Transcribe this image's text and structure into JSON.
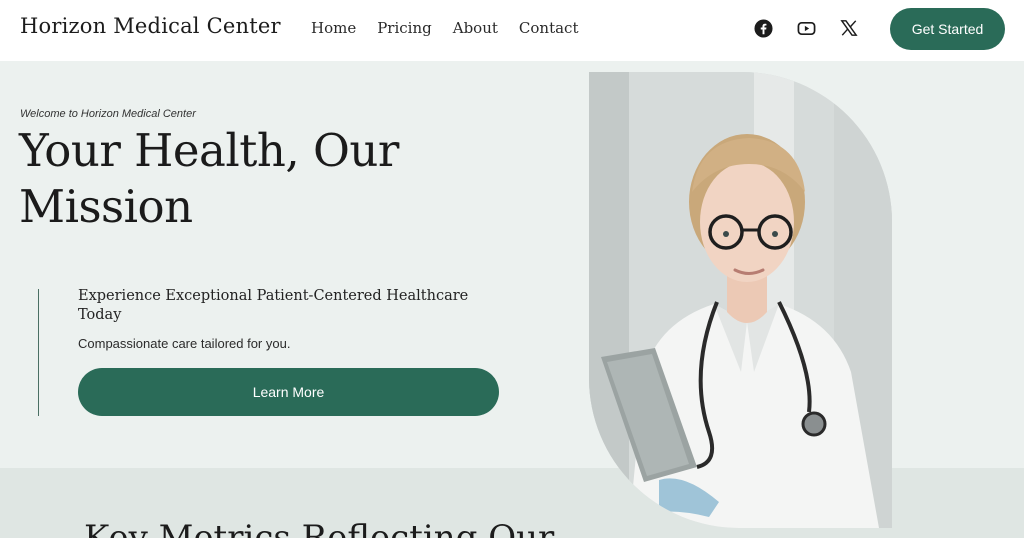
{
  "header": {
    "brand": "Horizon Medical Center",
    "nav": [
      "Home",
      "Pricing",
      "About",
      "Contact"
    ],
    "socials": [
      "facebook-icon",
      "youtube-icon",
      "x-icon"
    ],
    "cta_label": "Get Started"
  },
  "hero": {
    "welcome": "Welcome to Horizon Medical Center",
    "headline": "Your Health, Our Mission",
    "subhead": "Experience Exceptional Patient-Centered Healthcare Today",
    "subtext": "Compassionate care tailored for you.",
    "button_label": "Learn More"
  },
  "metrics": {
    "title": "Key Metrics Reflecting Our"
  },
  "colors": {
    "accent": "#2a6b58",
    "hero_bg": "#ecf1ef",
    "section_bg": "#dfe6e3"
  }
}
